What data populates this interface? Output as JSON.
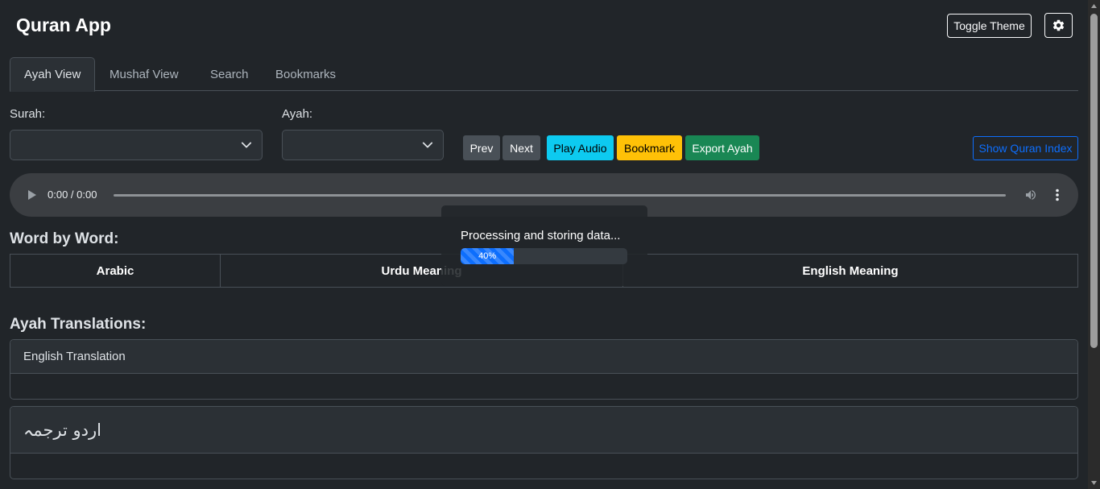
{
  "header": {
    "title": "Quran App",
    "toggle_theme_label": "Toggle Theme",
    "settings_icon": "gear-icon"
  },
  "tabs": [
    {
      "label": "Ayah View",
      "active": true
    },
    {
      "label": "Mushaf View",
      "active": false
    },
    {
      "label": "Search",
      "active": false
    },
    {
      "label": "Bookmarks",
      "active": false
    }
  ],
  "selectors": {
    "surah_label": "Surah:",
    "surah_value": "",
    "ayah_label": "Ayah:",
    "ayah_value": ""
  },
  "actions": {
    "prev": "Prev",
    "next": "Next",
    "play_audio": "Play Audio",
    "bookmark": "Bookmark",
    "export_ayah": "Export Ayah",
    "show_index": "Show Quran Index"
  },
  "audio": {
    "time": "0:00 / 0:00"
  },
  "word_by_word": {
    "heading": "Word by Word:",
    "columns": [
      "Arabic",
      "Urdu Meaning",
      "English Meaning"
    ]
  },
  "translations": {
    "heading": "Ayah Translations:",
    "english_header": "English Translation",
    "english_body": "",
    "urdu_header": "اردو ترجمہ",
    "urdu_body": ""
  },
  "loading": {
    "message": "Processing and storing data...",
    "progress_percent": 40,
    "progress_label": "40%"
  },
  "colors": {
    "background": "#212529",
    "primary": "#0d6efd",
    "info": "#0dcaf0",
    "warning": "#ffc107",
    "success": "#198754",
    "secondary": "#495057"
  }
}
